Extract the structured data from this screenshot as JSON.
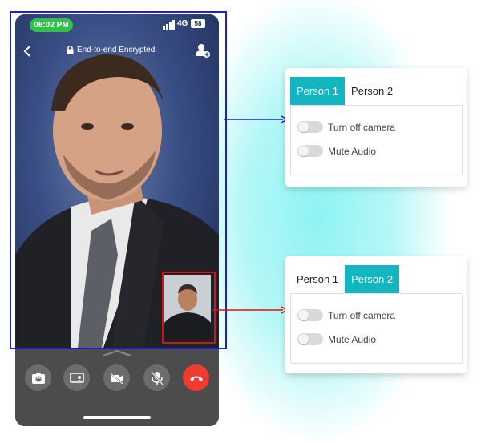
{
  "status_bar": {
    "time": "06:02 PM",
    "network": "4G",
    "battery": "58"
  },
  "call_header": {
    "encryption_label": "End-to-end Encrypted"
  },
  "controls": {
    "icons": [
      "flip-camera-icon",
      "share-screen-icon",
      "camera-off-icon",
      "mic-off-icon",
      "end-call-icon"
    ]
  },
  "panels": [
    {
      "tabs": [
        {
          "label": "Person 1",
          "active": true
        },
        {
          "label": "Person 2",
          "active": false
        }
      ],
      "options": [
        {
          "label": "Turn off camera",
          "on": false
        },
        {
          "label": "Mute Audio",
          "on": false
        }
      ]
    },
    {
      "tabs": [
        {
          "label": "Person 1",
          "active": false
        },
        {
          "label": "Person 2",
          "active": true
        }
      ],
      "options": [
        {
          "label": "Turn off camera",
          "on": false
        },
        {
          "label": "Mute Audio",
          "on": false
        }
      ]
    }
  ],
  "colors": {
    "accent": "#13b5c1",
    "end_call": "#ef3b30",
    "highlight_blue": "#1d22c6",
    "highlight_red": "#d11414"
  }
}
